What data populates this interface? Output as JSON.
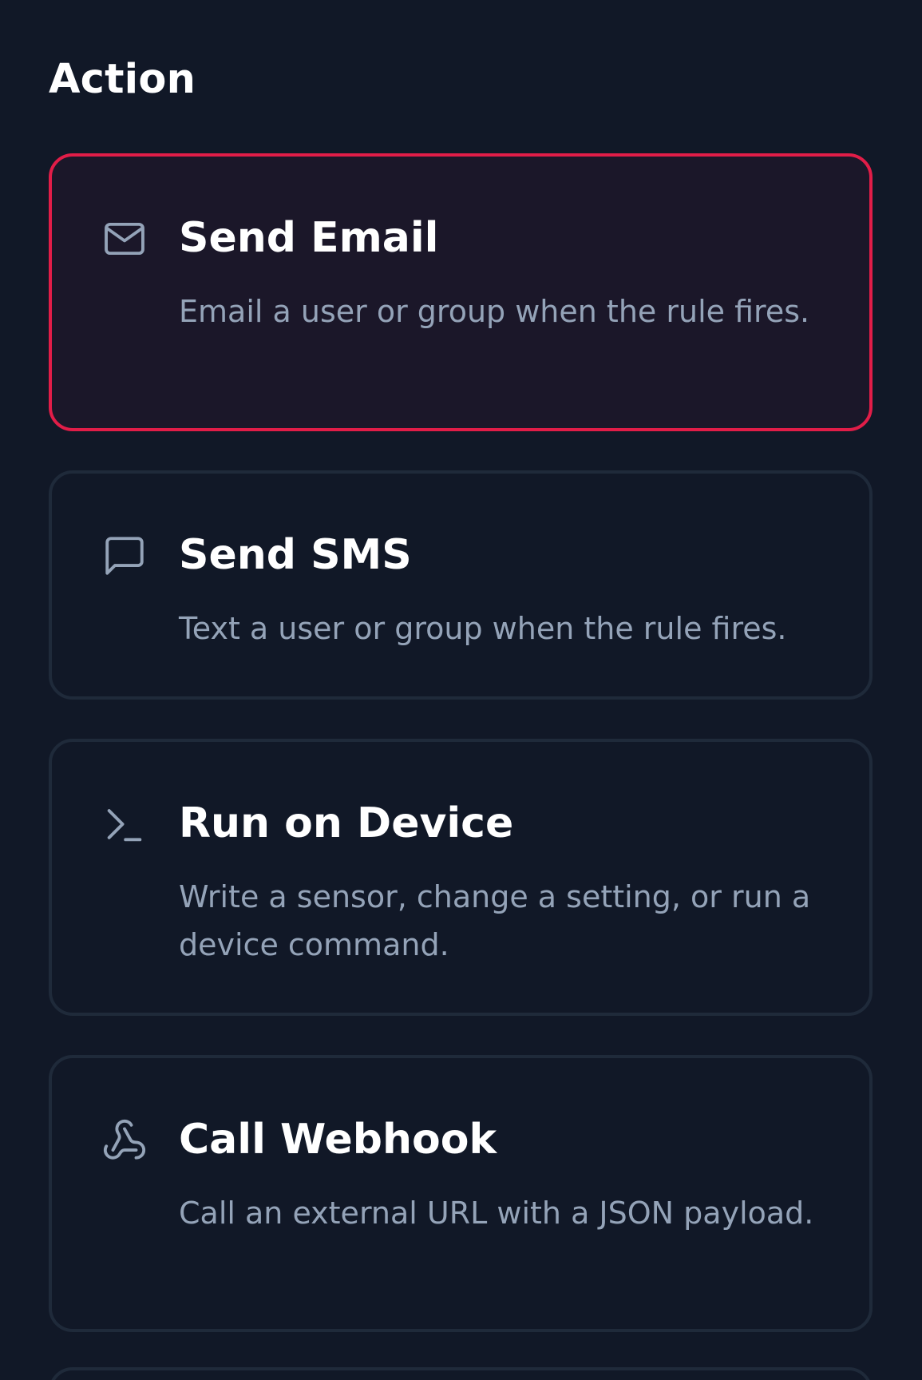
{
  "section": {
    "title": "Action"
  },
  "actions": [
    {
      "title": "Send Email",
      "description": "Email a user or group when the rule fires.",
      "icon": "mail-icon",
      "selected": true
    },
    {
      "title": "Send SMS",
      "description": "Text a user or group when the rule fires.",
      "icon": "message-square-icon",
      "selected": false
    },
    {
      "title": "Run on Device",
      "description": "Write a sensor, change a setting, or run a device command.",
      "icon": "terminal-icon",
      "selected": false
    },
    {
      "title": "Call Webhook",
      "description": "Call an external URL with a JSON payload.",
      "icon": "webhook-icon",
      "selected": false
    }
  ],
  "colors": {
    "background": "#111827",
    "selected_border": "#e11d48",
    "selected_background": "#1b1729",
    "card_border": "#1f2a3a",
    "title_text": "#ffffff",
    "description_text": "#94a3b8",
    "icon_color": "#94a3b8"
  }
}
